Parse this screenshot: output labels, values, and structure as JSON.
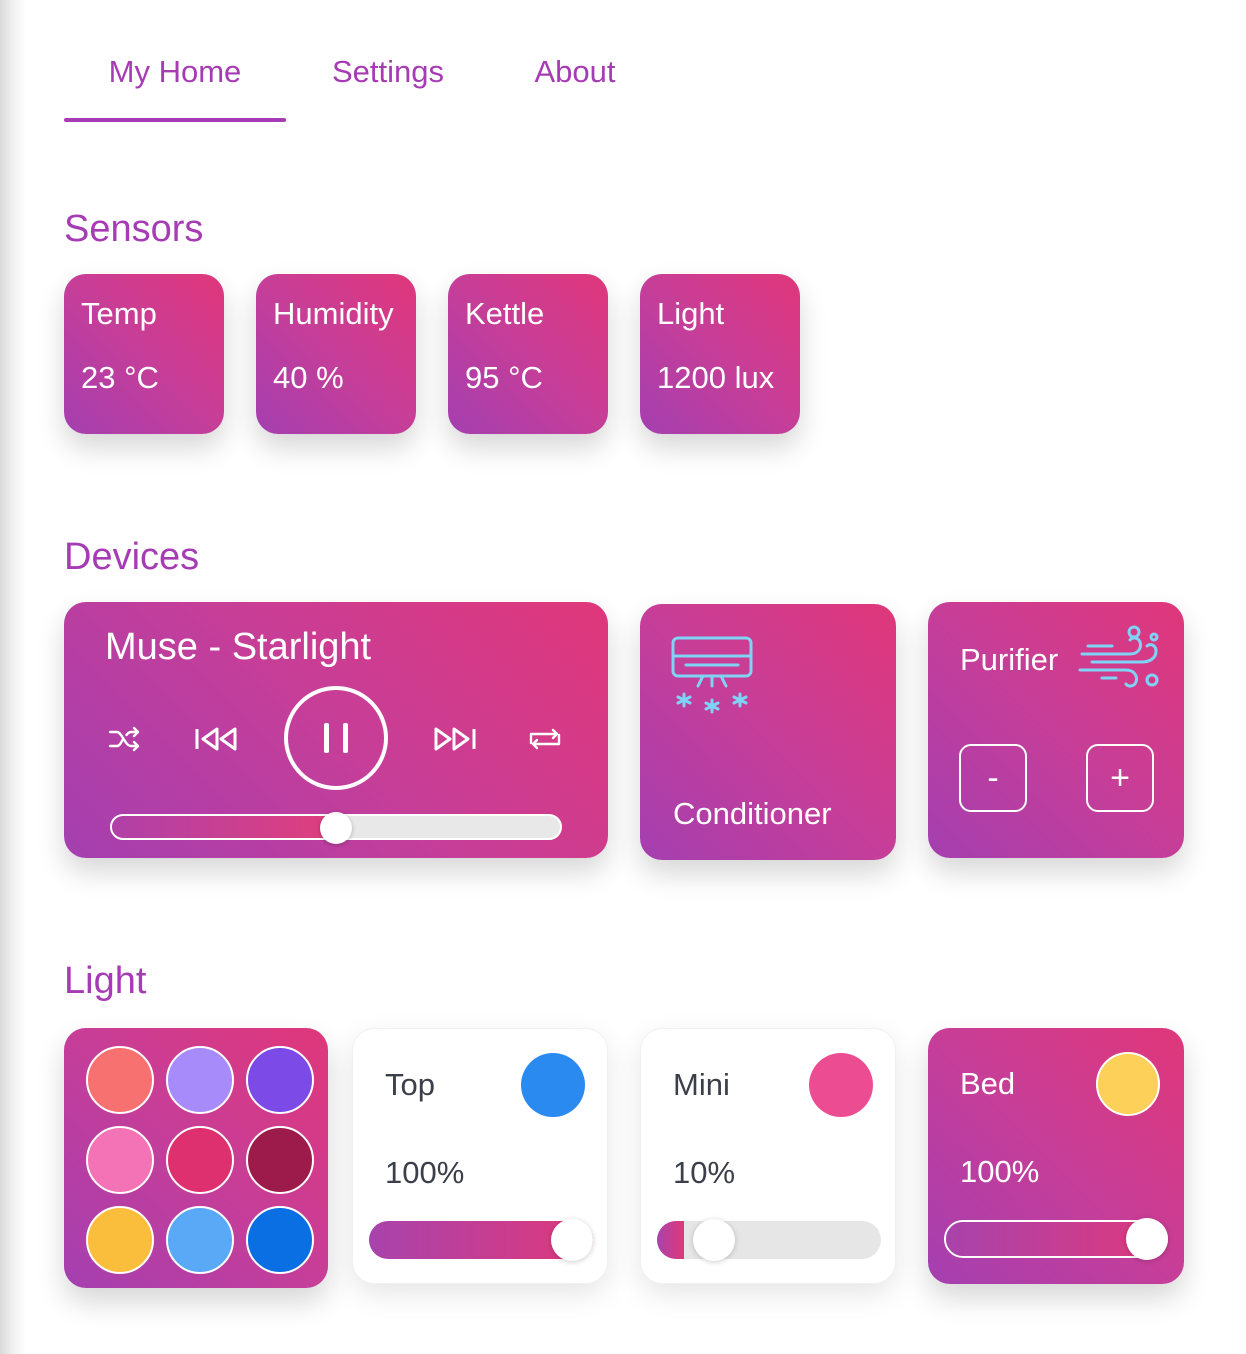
{
  "tabs": [
    {
      "label": "My Home",
      "active": true
    },
    {
      "label": "Settings",
      "active": false
    },
    {
      "label": "About",
      "active": false
    }
  ],
  "sections": {
    "sensors": "Sensors",
    "devices": "Devices",
    "light": "Light"
  },
  "sensors": [
    {
      "name": "Temp",
      "value": "23 °C"
    },
    {
      "name": "Humidity",
      "value": "40 %"
    },
    {
      "name": "Kettle",
      "value": "95 °C"
    },
    {
      "name": "Light",
      "value": "1200 lux"
    }
  ],
  "player": {
    "song": "Muse - Starlight",
    "progress": 0.5,
    "icons": [
      "shuffle-icon",
      "previous-icon",
      "pause-icon",
      "next-icon",
      "repeat-icon"
    ]
  },
  "conditioner": {
    "label": "Conditioner",
    "icon": "air-conditioner-icon"
  },
  "purifier": {
    "label": "Purifier",
    "icon": "wind-icon",
    "minus": "-",
    "plus": "+"
  },
  "palette": [
    "#f87171",
    "#a78bfa",
    "#7c4ae6",
    "#f472b6",
    "#de2f6e",
    "#9d1b4b",
    "#fbbd3c",
    "#5aa9f7",
    "#0a6fe3"
  ],
  "lights": [
    {
      "name": "Top",
      "percent_label": "100%",
      "level": 1.0,
      "color": "#2b8af0",
      "style": "white"
    },
    {
      "name": "Mini",
      "percent_label": "10%",
      "level": 0.1,
      "color": "#ec4d92",
      "style": "white"
    },
    {
      "name": "Bed",
      "percent_label": "100%",
      "level": 1.0,
      "color": "#fdd05a",
      "style": "gradient"
    }
  ],
  "colors": {
    "accent": "#a63cb3",
    "gradient_start": "#a43fb0",
    "gradient_end": "#e0377a"
  }
}
